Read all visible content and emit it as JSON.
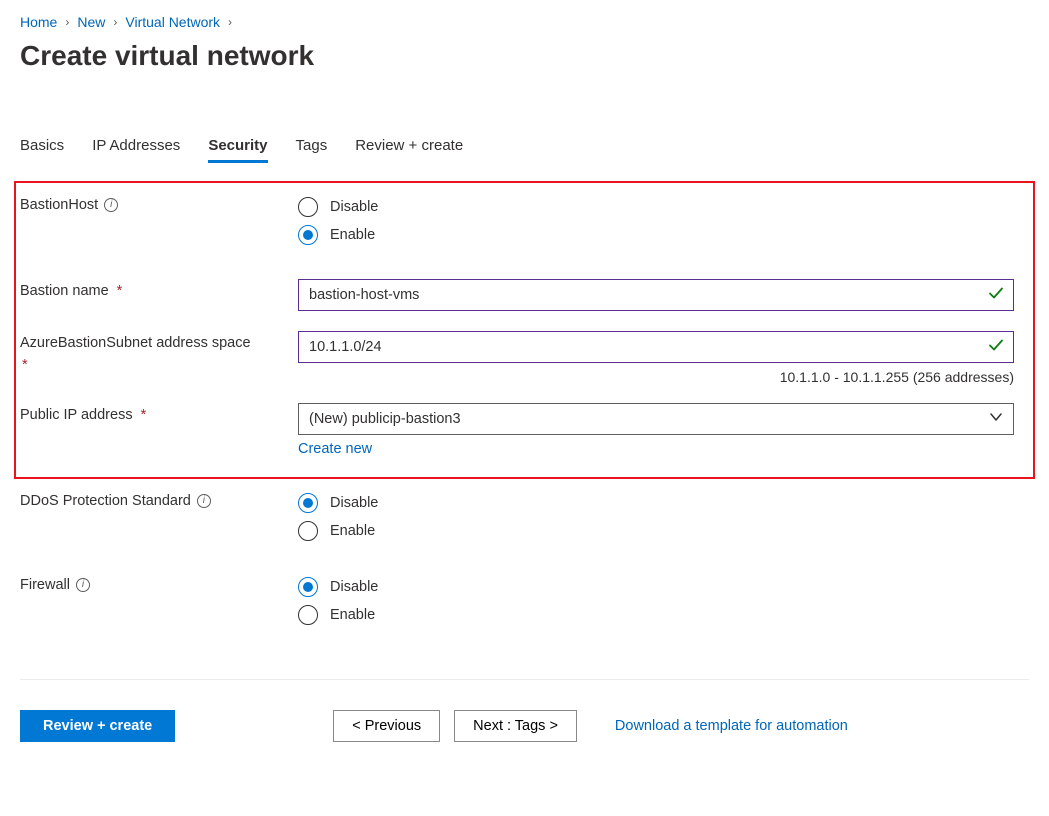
{
  "breadcrumb": {
    "items": [
      "Home",
      "New",
      "Virtual Network"
    ]
  },
  "page_title": "Create virtual network",
  "tabs": {
    "items": [
      "Basics",
      "IP Addresses",
      "Security",
      "Tags",
      "Review + create"
    ],
    "active_index": 2
  },
  "security": {
    "bastion_host": {
      "label": "BastionHost",
      "options": {
        "disable": "Disable",
        "enable": "Enable"
      },
      "selected": "enable"
    },
    "bastion_name": {
      "label": "Bastion name",
      "value": "bastion-host-vms",
      "required": true,
      "valid": true
    },
    "bastion_subnet": {
      "label": "AzureBastionSubnet address space",
      "value": "10.1.1.0/24",
      "required": true,
      "valid": true,
      "hint": "10.1.1.0 - 10.1.1.255 (256 addresses)"
    },
    "public_ip": {
      "label": "Public IP address",
      "value": "(New) publicip-bastion3",
      "required": true,
      "create_new_label": "Create new"
    },
    "ddos": {
      "label": "DDoS Protection Standard",
      "options": {
        "disable": "Disable",
        "enable": "Enable"
      },
      "selected": "disable"
    },
    "firewall": {
      "label": "Firewall",
      "options": {
        "disable": "Disable",
        "enable": "Enable"
      },
      "selected": "disable"
    }
  },
  "footer": {
    "review_create": "Review + create",
    "previous": "< Previous",
    "next": "Next : Tags >",
    "download_template": "Download a template for automation"
  }
}
